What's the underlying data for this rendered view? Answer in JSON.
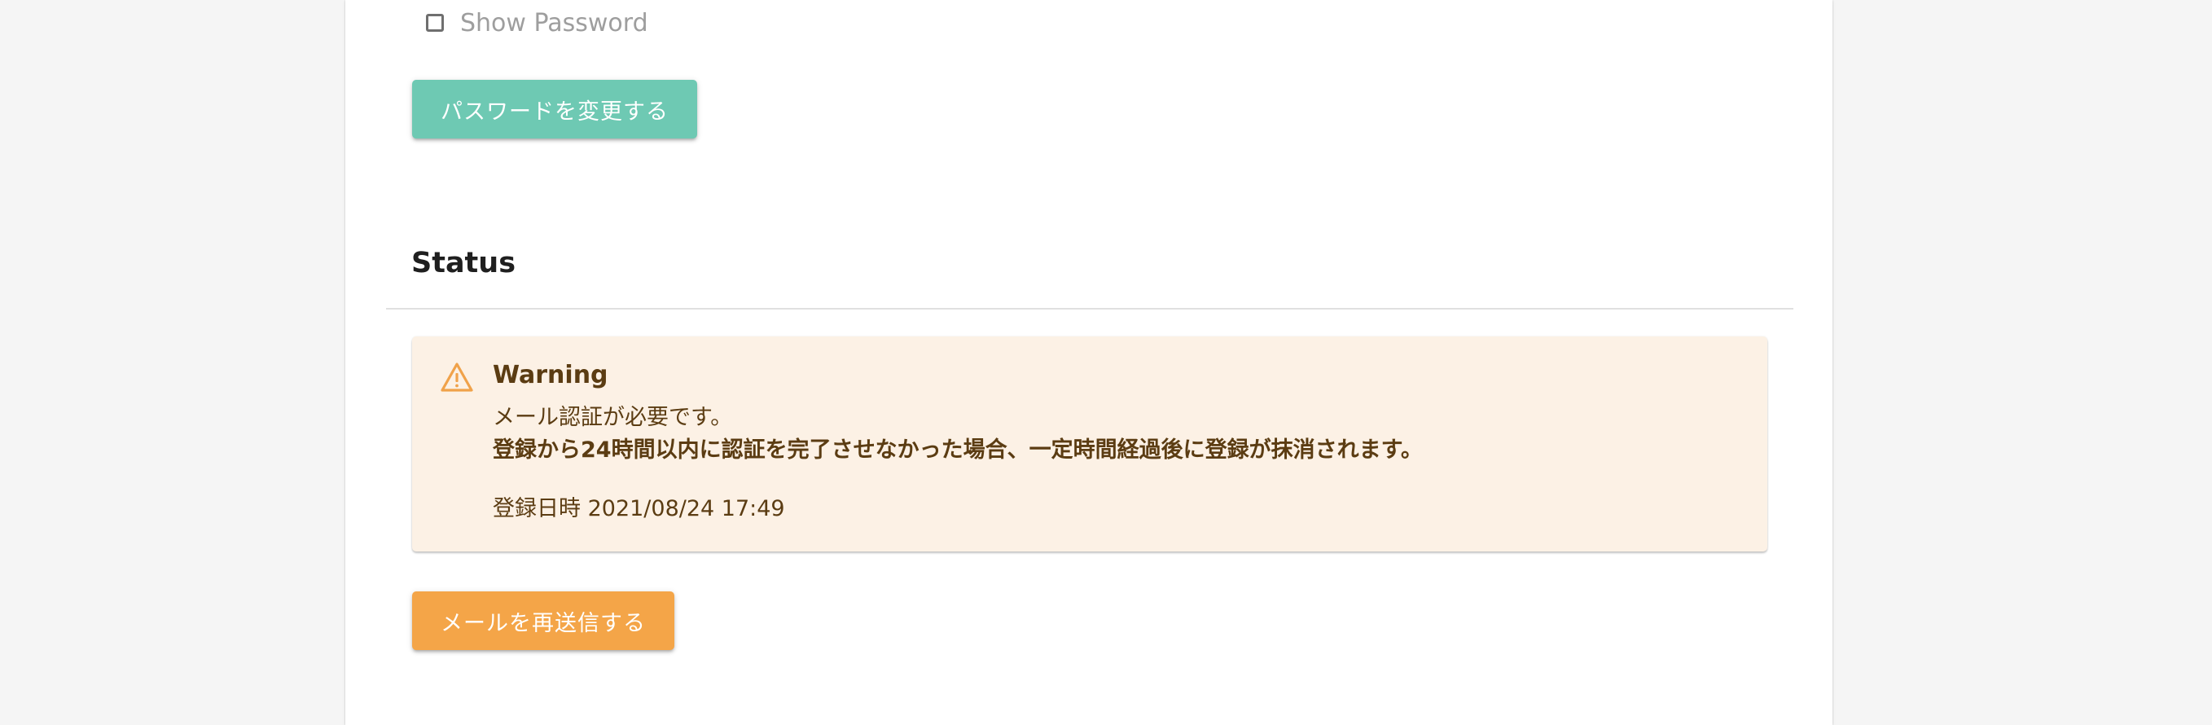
{
  "password": {
    "show_password_label": "Show Password",
    "change_button_label": "パスワードを変更する"
  },
  "status": {
    "section_title": "Status",
    "alert": {
      "icon": "warning-triangle-icon",
      "title": "Warning",
      "line1": "メール認証が必要です。",
      "line2": "登録から24時間以内に認証を完了させなかった場合、一定時間経過後に登録が抹消されます。",
      "registered_at": "登録日時 2021/08/24 17:49"
    },
    "resend_button_label": "メールを再送信する"
  },
  "colors": {
    "primary_teal": "#6ec9b3",
    "warning_orange": "#f4a548",
    "alert_background": "#fcf1e5",
    "alert_text": "#5b3c12",
    "warning_icon": "#f0a24a"
  }
}
